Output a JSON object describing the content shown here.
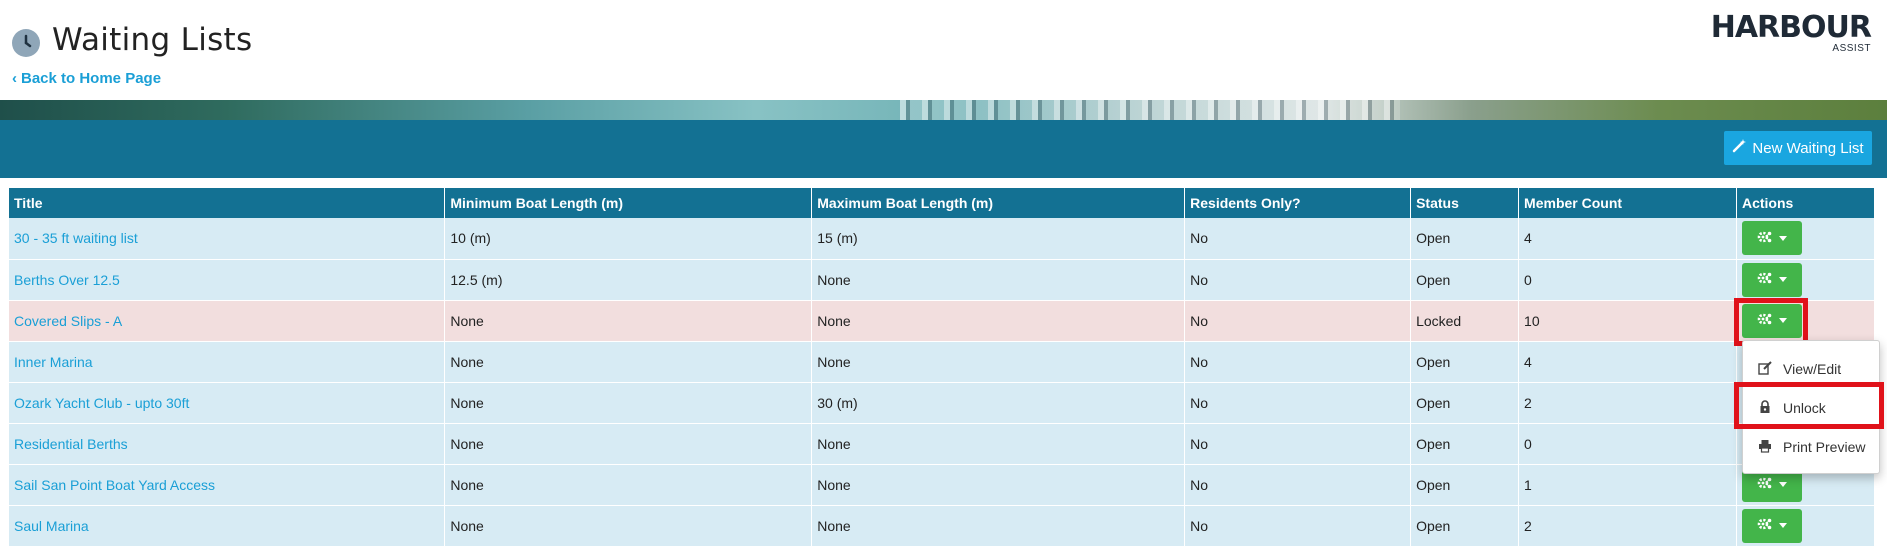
{
  "header": {
    "title": "Waiting Lists",
    "back_link": "Back to Home Page",
    "logo_main": "HARBOUR",
    "logo_sub": "ASSIST"
  },
  "toolbar": {
    "new_button": "New Waiting List"
  },
  "table": {
    "columns": [
      "Title",
      "Minimum Boat Length (m)",
      "Maximum Boat Length (m)",
      "Residents Only?",
      "Status",
      "Member Count",
      "Actions"
    ],
    "rows": [
      {
        "title": "30 - 35 ft waiting list",
        "min": "10 (m)",
        "max": "15 (m)",
        "residents": "No",
        "status": "Open",
        "count": "4"
      },
      {
        "title": "Berths Over 12.5",
        "min": "12.5 (m)",
        "max": "None",
        "residents": "No",
        "status": "Open",
        "count": "0"
      },
      {
        "title": "Covered Slips - A",
        "min": "None",
        "max": "None",
        "residents": "No",
        "status": "Locked",
        "count": "10"
      },
      {
        "title": "Inner Marina",
        "min": "None",
        "max": "None",
        "residents": "No",
        "status": "Open",
        "count": "4"
      },
      {
        "title": "Ozark Yacht Club - upto 30ft",
        "min": "None",
        "max": "30 (m)",
        "residents": "No",
        "status": "Open",
        "count": "2"
      },
      {
        "title": "Residential Berths",
        "min": "None",
        "max": "None",
        "residents": "No",
        "status": "Open",
        "count": "0"
      },
      {
        "title": "Sail San Point Boat Yard Access",
        "min": "None",
        "max": "None",
        "residents": "No",
        "status": "Open",
        "count": "1"
      },
      {
        "title": "Saul Marina",
        "min": "None",
        "max": "None",
        "residents": "No",
        "status": "Open",
        "count": "2"
      }
    ]
  },
  "dropdown": {
    "items": [
      "View/Edit",
      "Unlock",
      "Print Preview"
    ]
  },
  "colors": {
    "primary_band": "#137193",
    "link": "#1a9fd6",
    "action_green": "#43b54a",
    "highlight_red": "#e0121a",
    "locked_row": "#f2dede",
    "row_bg": "#d7ebf4"
  },
  "icons": {
    "title": "clock-icon",
    "new_button": "magic-wand-icon",
    "actions": "gear-icon",
    "view_edit": "edit-icon",
    "unlock": "lock-icon",
    "print": "print-icon"
  }
}
